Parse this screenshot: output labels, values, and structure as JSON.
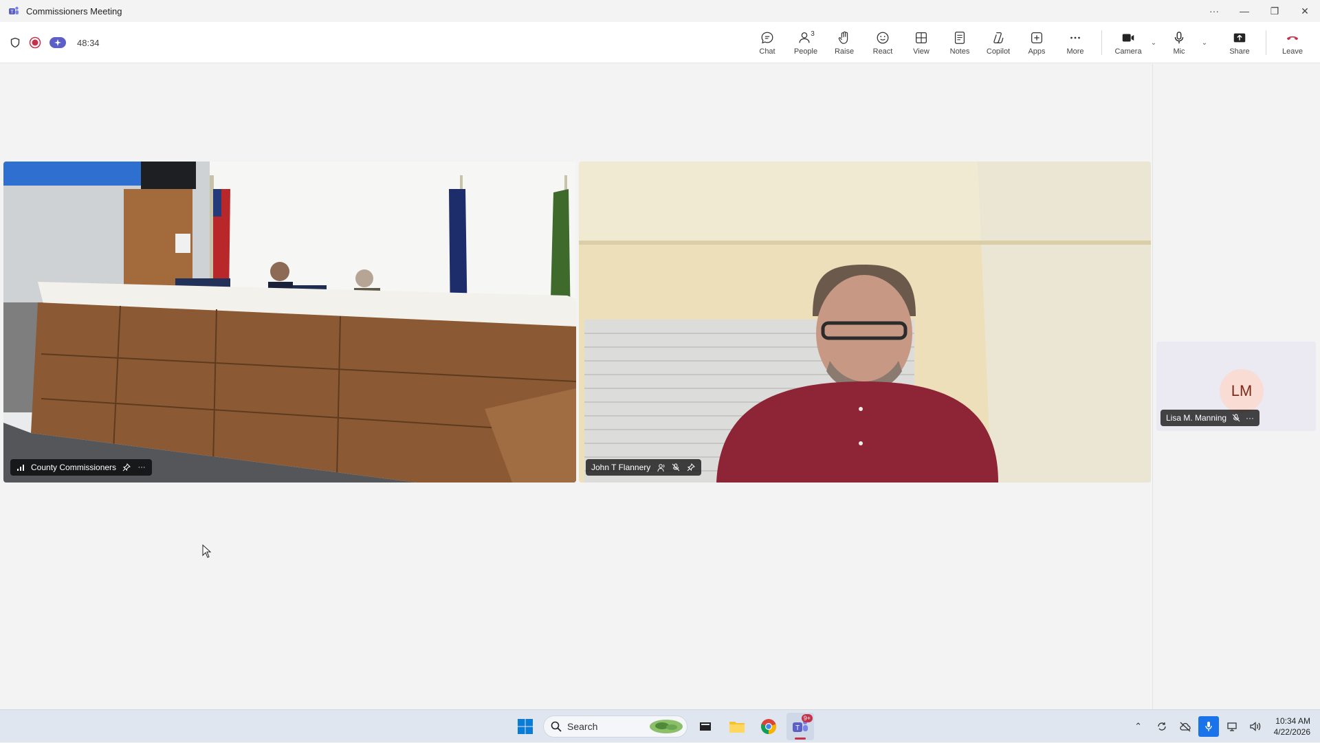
{
  "window": {
    "title": "Commissioners Meeting",
    "controls": [
      "more-icon",
      "minimize-icon",
      "restore-icon",
      "close-icon"
    ]
  },
  "toolbar": {
    "timer": "48:34",
    "buttons": [
      {
        "label": "Chat",
        "icon": "chat-icon"
      },
      {
        "label": "People",
        "icon": "people-icon",
        "count": "3"
      },
      {
        "label": "Raise",
        "icon": "hand-icon"
      },
      {
        "label": "React",
        "icon": "smile-icon"
      },
      {
        "label": "View",
        "icon": "grid-icon"
      },
      {
        "label": "Notes",
        "icon": "notes-icon"
      },
      {
        "label": "Copilot",
        "icon": "copilot-icon"
      },
      {
        "label": "Apps",
        "icon": "plus-icon"
      },
      {
        "label": "More",
        "icon": "ellipsis-icon"
      }
    ],
    "camera_label": "Camera",
    "mic_label": "Mic",
    "share_label": "Share",
    "leave_label": "Leave",
    "leave_color": "#c4314b",
    "record_color": "#c4314b",
    "accent": "#5b5fc7"
  },
  "tiles": [
    {
      "name": "County Commissioners"
    },
    {
      "name": "John T Flannery"
    }
  ],
  "side_participant": {
    "initials": "LM",
    "name": "Lisa M. Manning"
  },
  "taskbar": {
    "search_placeholder": "Search",
    "teams_badge": "9+",
    "time": "10:34 AM",
    "date": "4/22/2026"
  }
}
